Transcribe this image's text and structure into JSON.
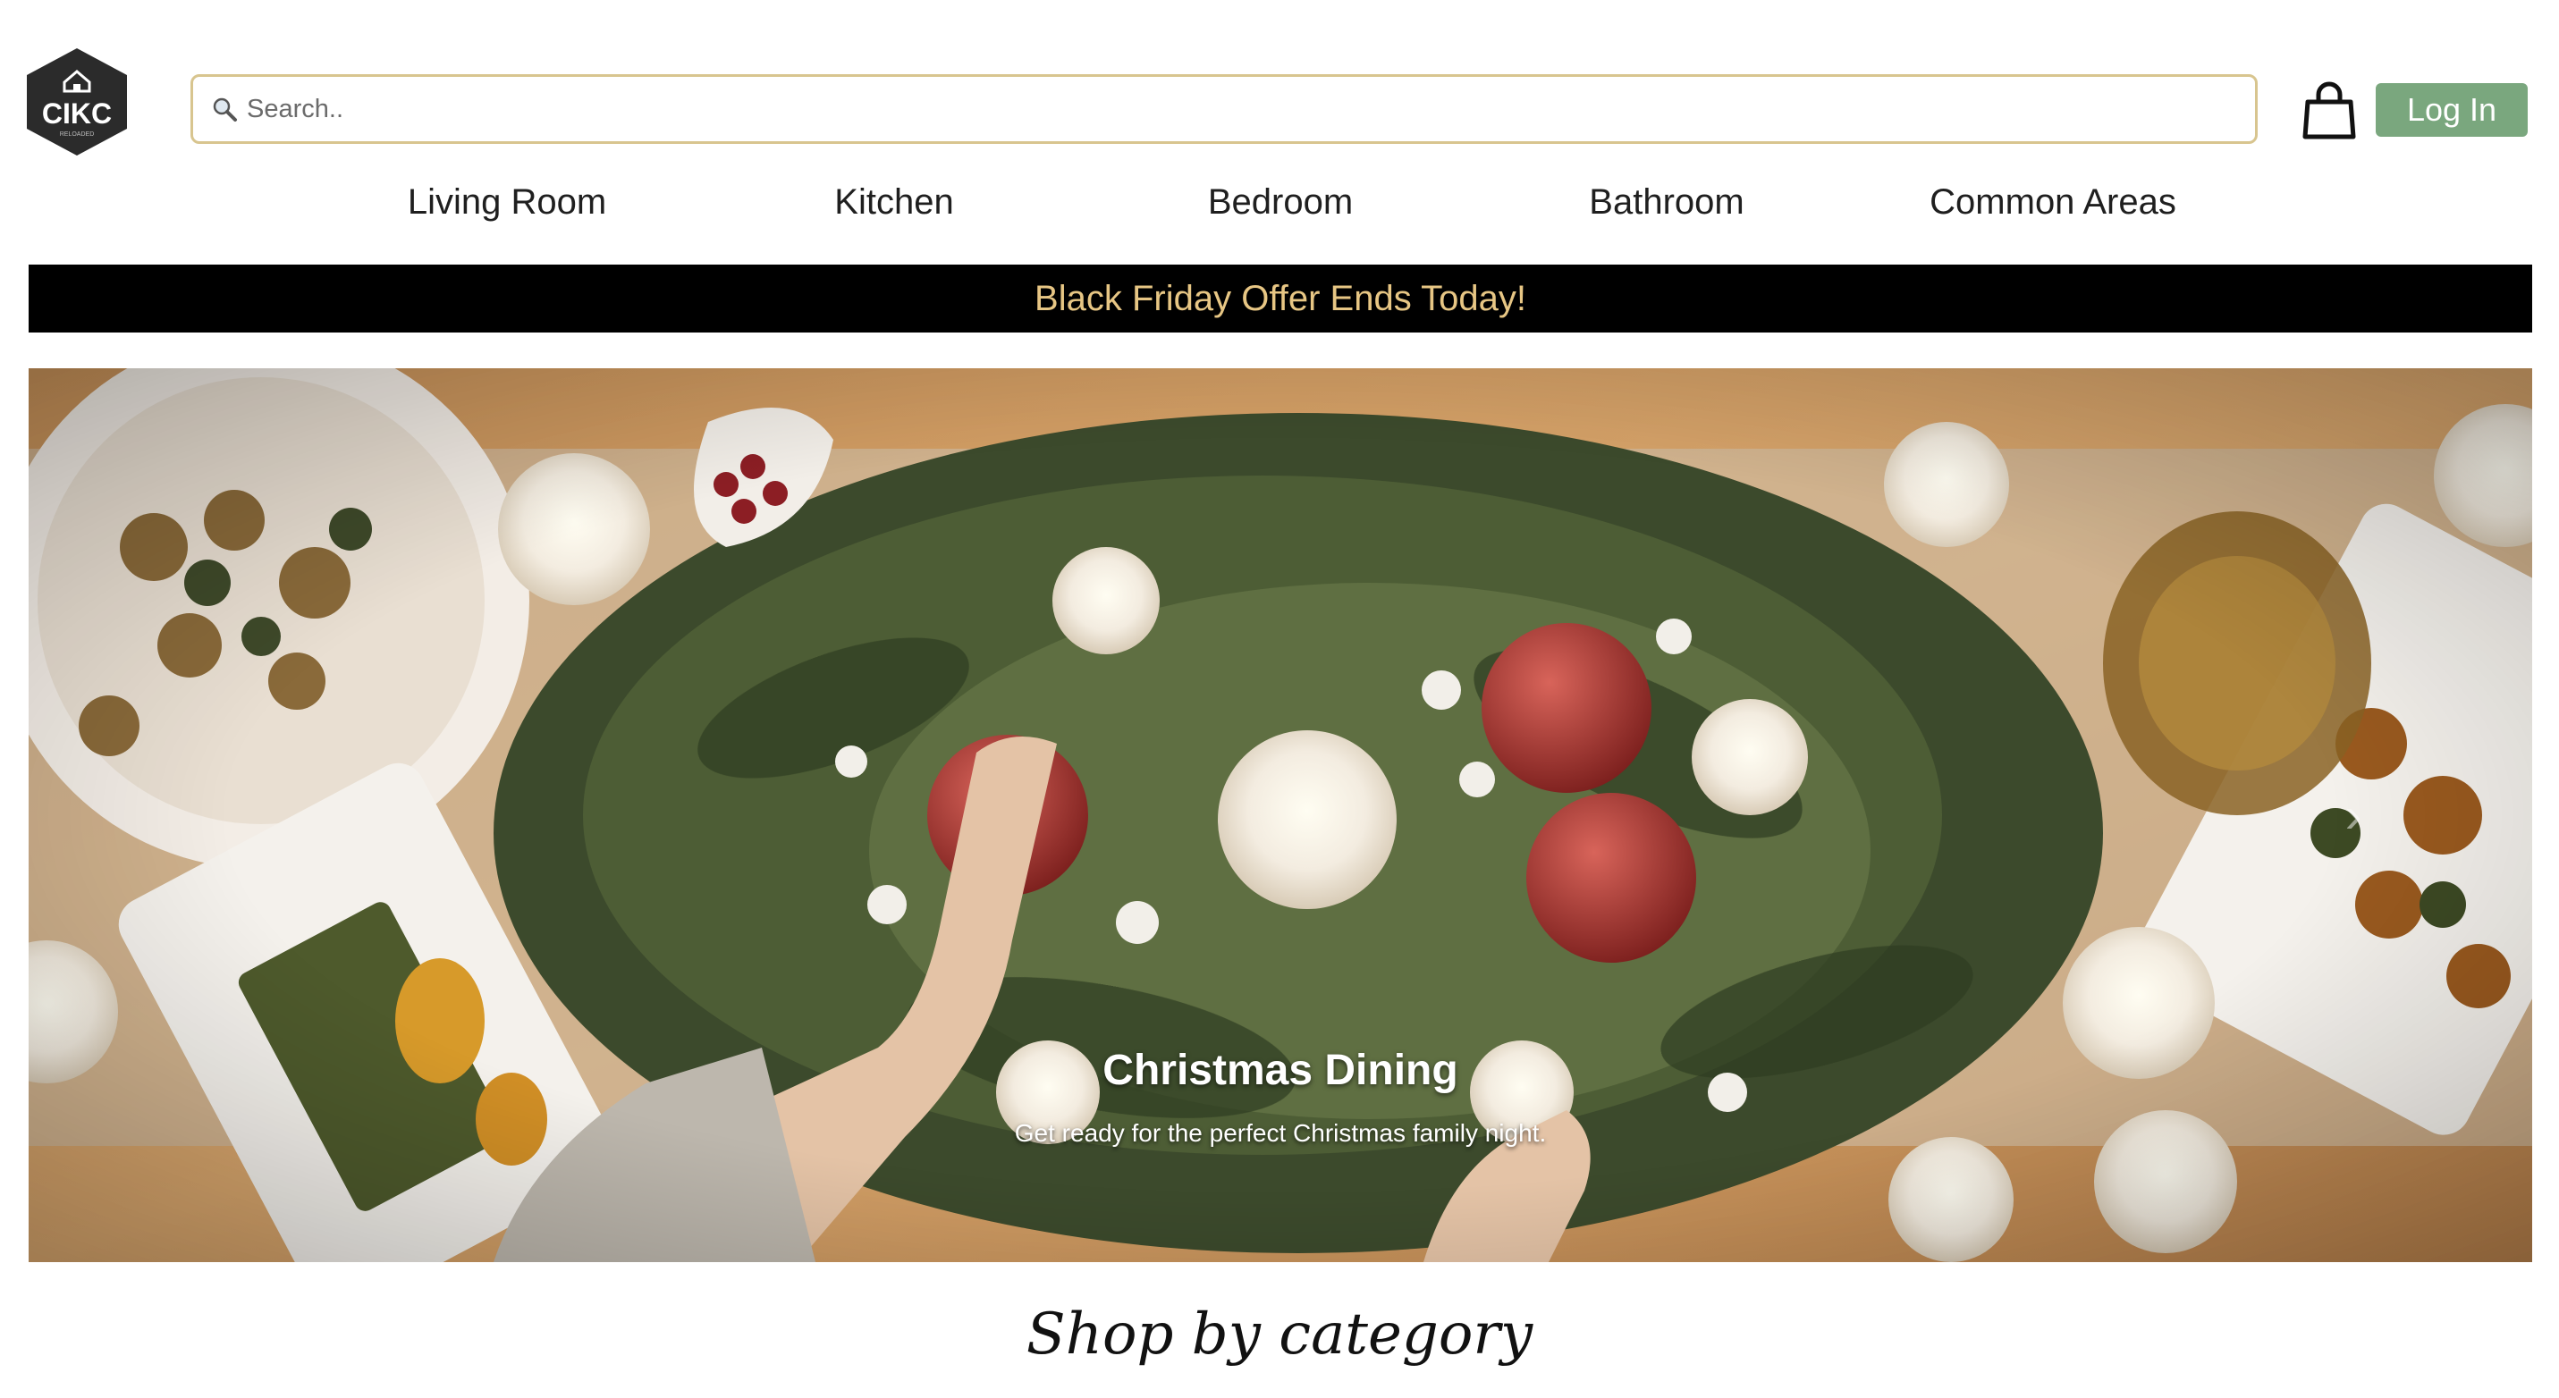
{
  "header": {
    "logo_text": "CIKC",
    "logo_subtext": "RELOADED",
    "search_placeholder": "Search..",
    "login_label": "Log In"
  },
  "nav": {
    "items": [
      "Living Room",
      "Kitchen",
      "Bedroom",
      "Bathroom",
      "Common Areas"
    ]
  },
  "promo": {
    "text": "Black Friday Offer Ends Today!"
  },
  "hero": {
    "title": "Christmas Dining",
    "subtitle": "Get ready for the perfect Christmas family night.",
    "next_icon": "chevron-right-icon"
  },
  "sections": {
    "shop_by_category": "Shop by category"
  },
  "colors": {
    "promo_bg": "#000000",
    "promo_text": "#e7c684",
    "login_bg": "#7aa77e",
    "search_border": "#d8c58f"
  }
}
